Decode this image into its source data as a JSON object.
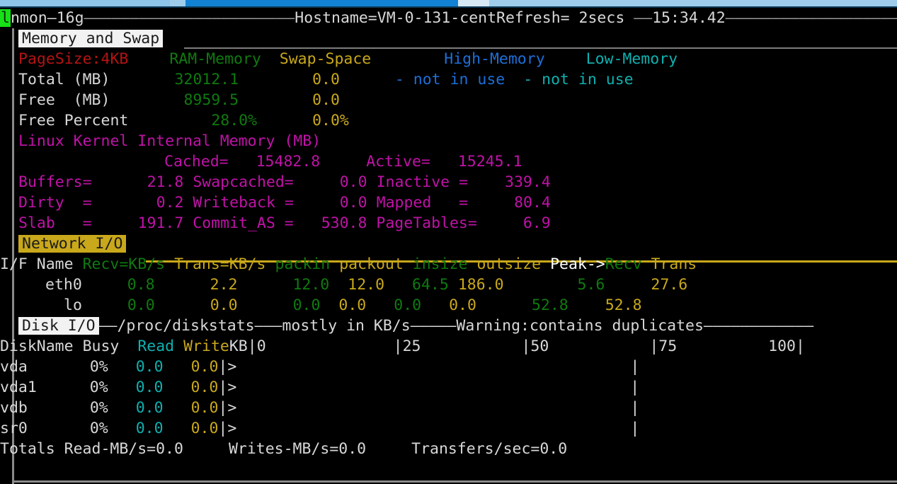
{
  "window": {
    "scrollbar": "horizontal-scrollbar"
  },
  "terminal": {
    "header": {
      "app": "nmon",
      "version": "16g",
      "dash1": "———————————————————————",
      "hostname_label": "Hostname=",
      "hostname": "VM-0-131-cent",
      "refresh_label": "Refresh=",
      "refresh_value": " 2secs ",
      "dash2": "——",
      "time": "15:34.42",
      "dash3": "————————————————————————————"
    },
    "cursor_char": "l"
  },
  "memory": {
    "section_title": "Memory and Swap",
    "columns": {
      "pagesize": "PageSize:4KB",
      "ram": "RAM-Memory",
      "swap": "Swap-Space",
      "high": "High-Memory",
      "low": "Low-Memory"
    },
    "rows": [
      {
        "label": "Total (MB)",
        "ram": "32012.1",
        "swap": "0.0",
        "high": "- not in use",
        "low": "- not in use"
      },
      {
        "label": "Free  (MB)",
        "ram": "8959.5",
        "swap": "0.0",
        "high": "",
        "low": ""
      },
      {
        "label": "Free Percent",
        "ram": "28.0%",
        "swap": "0.0%",
        "high": "",
        "low": ""
      }
    ]
  },
  "kernel_memory": {
    "title": "Linux Kernel Internal Memory (MB)",
    "fields": {
      "cached_label": "Cached=",
      "cached_value": "15482.8",
      "active_label": "Active=",
      "active_value": "15245.1",
      "buffers_label": "Buffers=",
      "buffers_value": "21.8",
      "swapcached_label": "Swapcached=",
      "swapcached_value": "0.0",
      "inactive_label": "Inactive =",
      "inactive_value": "339.4",
      "dirty_label": "Dirty  =",
      "dirty_value": "0.2",
      "writeback_label": "Writeback =",
      "writeback_value": "0.0",
      "mapped_label": "Mapped   =",
      "mapped_value": "80.4",
      "slab_label": "Slab   =",
      "slab_value": "191.7",
      "commit_label": "Commit_AS =",
      "commit_value": "530.8",
      "pagetables_label": "PageTables=",
      "pagetables_value": "6.9"
    }
  },
  "network": {
    "section_title": "Network I/O",
    "columns": {
      "ifname": "I/F Name",
      "recv": "Recv=KB/s",
      "trans": "Trans=KB/s",
      "packin": "packin",
      "packout": "packout",
      "insize": "insize",
      "outsize": "outsize",
      "peak": "Peak->",
      "peak_recv": "Recv",
      "peak_trans": "Trans"
    },
    "rows": [
      {
        "name": "eth0",
        "recv": "0.8",
        "trans": "2.2",
        "packin": "12.0",
        "packout": "12.0",
        "insize": "64.5",
        "outsize": "186.0",
        "peak_recv": "5.6",
        "peak_trans": "27.6"
      },
      {
        "name": "lo",
        "recv": "0.0",
        "trans": "0.0",
        "packin": "0.0",
        "packout": "0.0",
        "insize": "0.0",
        "outsize": "0.0",
        "peak_recv": "52.8",
        "peak_trans": "52.8"
      }
    ]
  },
  "disk": {
    "section_title": "Disk I/O",
    "header_dash1": "——",
    "header_source": "/proc/diskstats",
    "header_dash2": "———",
    "header_units": "mostly in KB/s",
    "header_dash3": "—————",
    "header_warning": "Warning:contains duplicates",
    "header_dash4": "————————————",
    "columns": {
      "name": "DiskName",
      "busy": "Busy",
      "read": "Read",
      "write": "Write",
      "kb": "KB"
    },
    "scale": {
      "t0": "|0",
      "t25": "|25",
      "t50": "|50",
      "t75": "|75",
      "t100": "100|"
    },
    "rows": [
      {
        "name": "vda",
        "busy": "0%",
        "read": "0.0",
        "write": "0.0",
        "bar": ">"
      },
      {
        "name": "vda1",
        "busy": "0%",
        "read": "0.0",
        "write": "0.0",
        "bar": ">"
      },
      {
        "name": "vdb",
        "busy": "0%",
        "read": "0.0",
        "write": "0.0",
        "bar": ">"
      },
      {
        "name": "sr0",
        "busy": "0%",
        "read": "0.0",
        "write": "0.0",
        "bar": ">"
      }
    ],
    "totals": {
      "label": "Totals",
      "read": "Read-MB/s=0.0",
      "write": "Writes-MB/s=0.0",
      "transfers": "Transfers/sec=0.0"
    }
  },
  "colors": {
    "background": "#000000",
    "default_text": "#d8d8d8",
    "red": "#b41313",
    "green": "#159015",
    "yellow": "#c9a81b",
    "blue": "#1d6fd8",
    "cyan": "#0fb0b0",
    "magenta": "#c012a8",
    "cursor": "#17e017",
    "header_bg_white": "#f2f2f2",
    "header_bg_yellow": "#c9a81b",
    "scrollbar_track": "#9dcdeb",
    "scrollbar_thumb": "#1283d4"
  }
}
